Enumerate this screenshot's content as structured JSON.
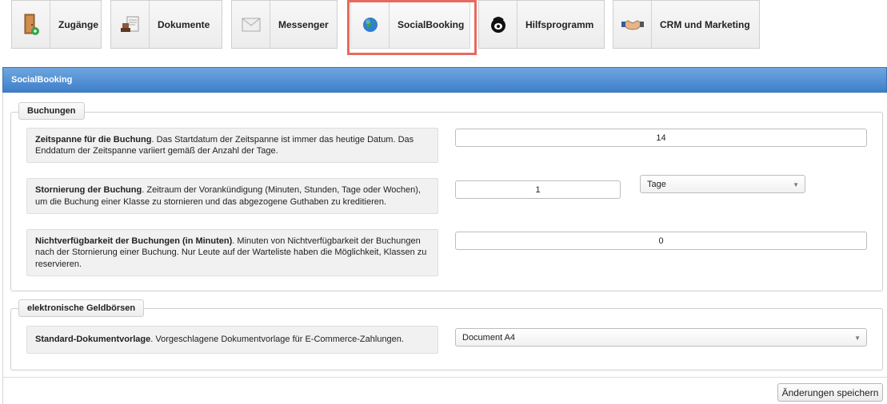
{
  "toolbar": {
    "tabs": [
      {
        "label": "Zugänge",
        "icon": "door-exit-icon"
      },
      {
        "label": "Dokumente",
        "icon": "stamp-document-icon"
      },
      {
        "label": "Messenger",
        "icon": "envelope-icon"
      },
      {
        "label": "SocialBooking",
        "icon": "globe-icon",
        "active": true
      },
      {
        "label": "Hilfsprogramm",
        "icon": "headset-icon"
      },
      {
        "label": "CRM und Marketing",
        "icon": "handshake-icon"
      }
    ]
  },
  "panel": {
    "title": "SocialBooking"
  },
  "sections": {
    "buchungen": {
      "legend": "Buchungen",
      "rows": [
        {
          "bold": "Zeitspanne für die Buchung",
          "text": ". Das Startdatum der Zeitspanne ist immer das heutige Datum. Das Enddatum der Zeitspanne variiert gemäß der Anzahl der Tage.",
          "value": "14"
        },
        {
          "bold": "Stornierung der Buchung",
          "text": ". Zeitraum der Vorankündigung (Minuten, Stunden, Tage oder Wochen), um die Buchung einer Klasse zu stornieren und das abgezogene Guthaben zu kreditieren.",
          "value": "1",
          "unit": "Tage"
        },
        {
          "bold": "Nichtverfügbarkeit der Buchungen (in Minuten)",
          "text": ". Minuten von Nichtverfügbarkeit der Buchungen nach der Stornierung einer Buchung. Nur Leute auf der Warteliste haben die Möglichkeit, Klassen zu reservieren.",
          "value": "0"
        }
      ]
    },
    "geldboersen": {
      "legend": "elektronische Geldbörsen",
      "rows": [
        {
          "bold": "Standard-Dokumentvorlage",
          "text": ". Vorgeschlagene Dokumentvorlage für E-Commerce-Zahlungen.",
          "value": "Document A4"
        }
      ]
    }
  },
  "actions": {
    "save_label": "Änderungen speichern"
  },
  "colors": {
    "titlebar": "#4a8ad2",
    "highlight": "#e86a5f"
  }
}
